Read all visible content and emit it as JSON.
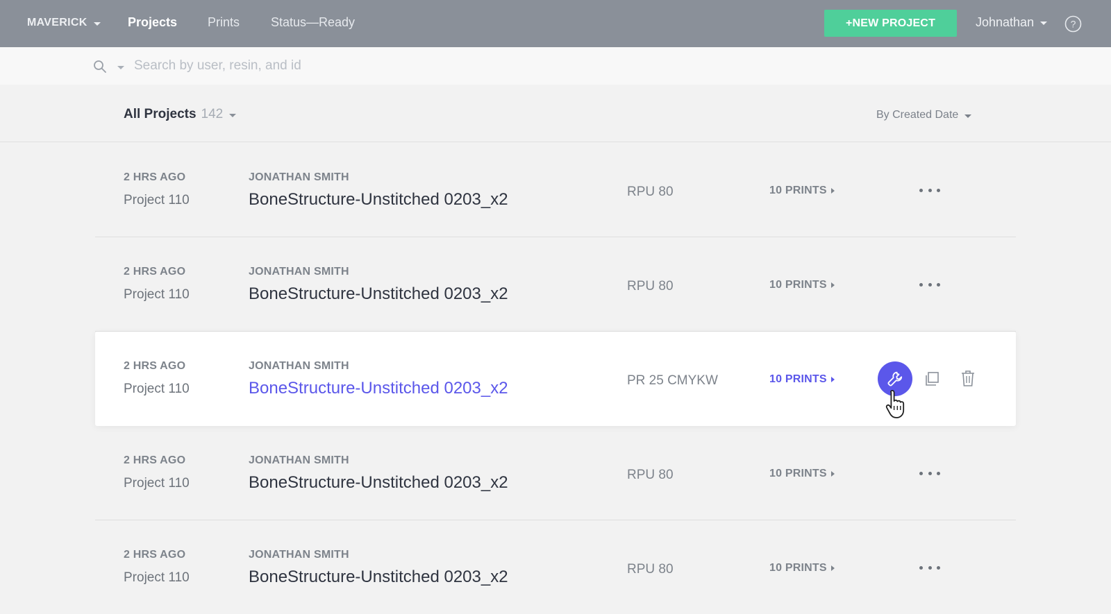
{
  "nav": {
    "brand": "MAVERICK",
    "items": [
      {
        "label": "Projects",
        "active": true
      },
      {
        "label": "Prints",
        "active": false
      },
      {
        "label": "Status—Ready",
        "active": false
      }
    ],
    "new_project_label": "+NEW PROJECT",
    "user_name": "Johnathan",
    "help_icon": "question-circle-icon"
  },
  "search": {
    "placeholder": "Search by user, resin, and id",
    "value": ""
  },
  "list_header": {
    "title": "All Projects",
    "count": "142",
    "sort_label": "By Created Date"
  },
  "rows": [
    {
      "time": "2 HRS AGO",
      "project_id": "Project 110",
      "author": "JONATHAN SMITH",
      "name": "BoneStructure-Unstitched 0203_x2",
      "resin": "RPU 80",
      "prints": "10 PRINTS",
      "active": false
    },
    {
      "time": "2 HRS AGO",
      "project_id": "Project 110",
      "author": "JONATHAN SMITH",
      "name": "BoneStructure-Unstitched 0203_x2",
      "resin": "RPU 80",
      "prints": "10 PRINTS",
      "active": false
    },
    {
      "time": "2 HRS AGO",
      "project_id": "Project 110",
      "author": "JONATHAN SMITH",
      "name": "BoneStructure-Unstitched 0203_x2",
      "resin": "PR 25 CMYKW",
      "prints": "10 PRINTS",
      "active": true
    },
    {
      "time": "2 HRS AGO",
      "project_id": "Project 110",
      "author": "JONATHAN SMITH",
      "name": "BoneStructure-Unstitched 0203_x2",
      "resin": "RPU 80",
      "prints": "10 PRINTS",
      "active": false
    },
    {
      "time": "2 HRS AGO",
      "project_id": "Project 110",
      "author": "JONATHAN SMITH",
      "name": "BoneStructure-Unstitched 0203_x2",
      "resin": "RPU 80",
      "prints": "10 PRINTS",
      "active": false
    }
  ],
  "colors": {
    "topbar": "#8a9099",
    "accent": "#5b57ea",
    "new_button": "#4fcf9a",
    "background": "#f2f2f2"
  }
}
